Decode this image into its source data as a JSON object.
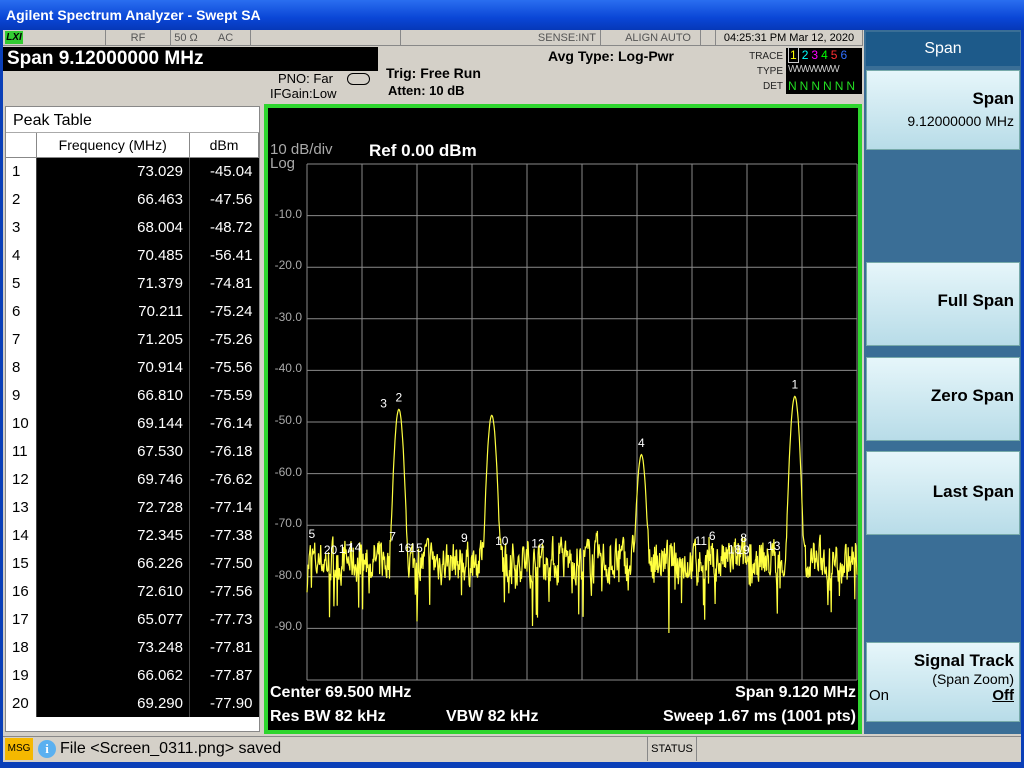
{
  "window_title": "Agilent Spectrum Analyzer - Swept SA",
  "status_bar": {
    "logo": "LXI",
    "rf": "RF",
    "impedance": "50 Ω",
    "coupling": "AC",
    "sense": "SENSE:INT",
    "align": "ALIGN AUTO",
    "datetime": "04:25:31 PM Mar 12, 2020"
  },
  "active_function": "Span  9.12000000 MHz",
  "settings": {
    "pno": "PNO: Far",
    "ifgain": "IFGain:Low",
    "trig": "Trig: Free Run",
    "atten": "Atten: 10 dB",
    "avg_type": "Avg Type: Log-Pwr"
  },
  "trace_box": {
    "trace_label": "TRACE",
    "type_label": "TYPE",
    "det_label": "DET",
    "traces": [
      "1",
      "2",
      "3",
      "4",
      "5",
      "6"
    ],
    "trace_colors": [
      "#ffff00",
      "#00ffff",
      "#ff00ff",
      "#00ff00",
      "#ff3030",
      "#3070ff"
    ],
    "types": "WWWWWW",
    "dets": [
      "N",
      "N",
      "N",
      "N",
      "N",
      "N"
    ]
  },
  "peak_table": {
    "title": "Peak Table",
    "headers": [
      "",
      "Frequency (MHz)",
      "dBm"
    ],
    "rows": [
      [
        "1",
        "73.029",
        "-45.04"
      ],
      [
        "2",
        "66.463",
        "-47.56"
      ],
      [
        "3",
        "68.004",
        "-48.72"
      ],
      [
        "4",
        "70.485",
        "-56.41"
      ],
      [
        "5",
        "71.379",
        "-74.81"
      ],
      [
        "6",
        "70.211",
        "-75.24"
      ],
      [
        "7",
        "71.205",
        "-75.26"
      ],
      [
        "8",
        "70.914",
        "-75.56"
      ],
      [
        "9",
        "66.810",
        "-75.59"
      ],
      [
        "10",
        "69.144",
        "-76.14"
      ],
      [
        "11",
        "67.530",
        "-76.18"
      ],
      [
        "12",
        "69.746",
        "-76.62"
      ],
      [
        "13",
        "72.728",
        "-77.14"
      ],
      [
        "14",
        "72.345",
        "-77.38"
      ],
      [
        "15",
        "66.226",
        "-77.50"
      ],
      [
        "16",
        "72.610",
        "-77.56"
      ],
      [
        "17",
        "65.077",
        "-77.73"
      ],
      [
        "18",
        "73.248",
        "-77.81"
      ],
      [
        "19",
        "66.062",
        "-77.87"
      ],
      [
        "20",
        "69.290",
        "-77.90"
      ]
    ]
  },
  "graph": {
    "scale": "10 dB/div",
    "scale_type": "Log",
    "ref": "Ref 0.00 dBm",
    "y_ticks": [
      "-10.0",
      "-20.0",
      "-30.0",
      "-40.0",
      "-50.0",
      "-60.0",
      "-70.0",
      "-80.0",
      "-90.0"
    ],
    "center": "Center 69.500 MHz",
    "span": "Span 9.120 MHz",
    "rbw": "Res BW 82 kHz",
    "vbw": "VBW 82 kHz",
    "sweep": "Sweep  1.67 ms (1001 pts)",
    "trace_color": "#ffff40",
    "marker_labels": [
      {
        "n": "1",
        "f": 73.029
      },
      {
        "n": "2",
        "f": 66.463
      },
      {
        "n": "3",
        "f": 66.21
      },
      {
        "n": "4",
        "f": 70.485
      },
      {
        "n": "5",
        "f": 65.02
      },
      {
        "n": "7",
        "f": 66.36
      },
      {
        "n": "8",
        "f": 72.18
      },
      {
        "n": "9",
        "f": 67.55
      },
      {
        "n": "10",
        "f": 68.17
      },
      {
        "n": "11",
        "f": 71.47
      },
      {
        "n": "6",
        "f": 71.66
      },
      {
        "n": "12",
        "f": 68.77
      },
      {
        "n": "13",
        "f": 72.68
      },
      {
        "n": "14",
        "f": 65.73
      },
      {
        "n": "15",
        "f": 66.75
      },
      {
        "n": "16",
        "f": 66.56
      },
      {
        "n": "17",
        "f": 65.58
      },
      {
        "n": "18",
        "f": 72.03
      },
      {
        "n": "19",
        "f": 72.17
      },
      {
        "n": "20",
        "f": 65.33
      }
    ]
  },
  "softkeys": {
    "title": "Span",
    "span_label": "Span",
    "span_value": "9.12000000 MHz",
    "full_span": "Full Span",
    "zero_span": "Zero Span",
    "last_span": "Last Span",
    "signal_track": "Signal Track",
    "signal_track_sub": "(Span Zoom)",
    "on": "On",
    "off": "Off"
  },
  "message": {
    "tag": "MSG",
    "text": "File <Screen_0311.png> saved",
    "status": "STATUS"
  }
}
